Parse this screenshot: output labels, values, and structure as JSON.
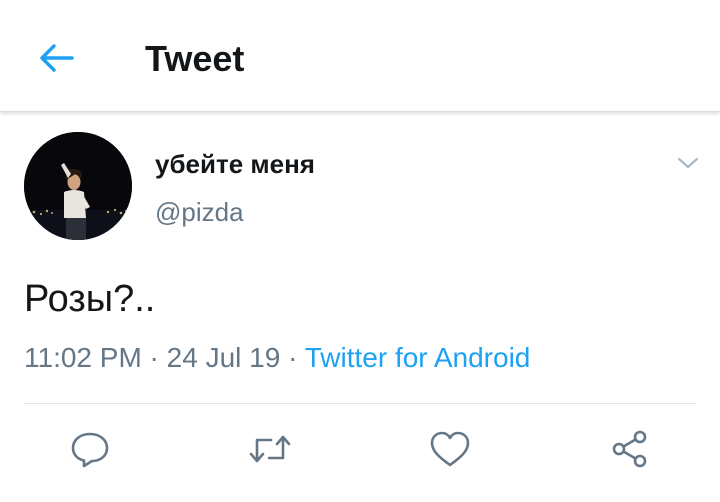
{
  "header": {
    "title": "Tweet",
    "back_icon": "arrow-left-icon"
  },
  "tweet": {
    "display_name": "убейте меня",
    "handle": "@pizda",
    "text": "Розы?..",
    "time": "11:02 PM",
    "separator": " · ",
    "date": "24 Jul 19",
    "source": "Twitter for Android"
  },
  "actions": {
    "reply_icon": "reply-icon",
    "retweet_icon": "retweet-icon",
    "like_icon": "heart-icon",
    "share_icon": "share-icon"
  },
  "colors": {
    "accent": "#1da1f2",
    "text_primary": "#14171a",
    "text_secondary": "#657786",
    "icon_gray": "#657786"
  }
}
